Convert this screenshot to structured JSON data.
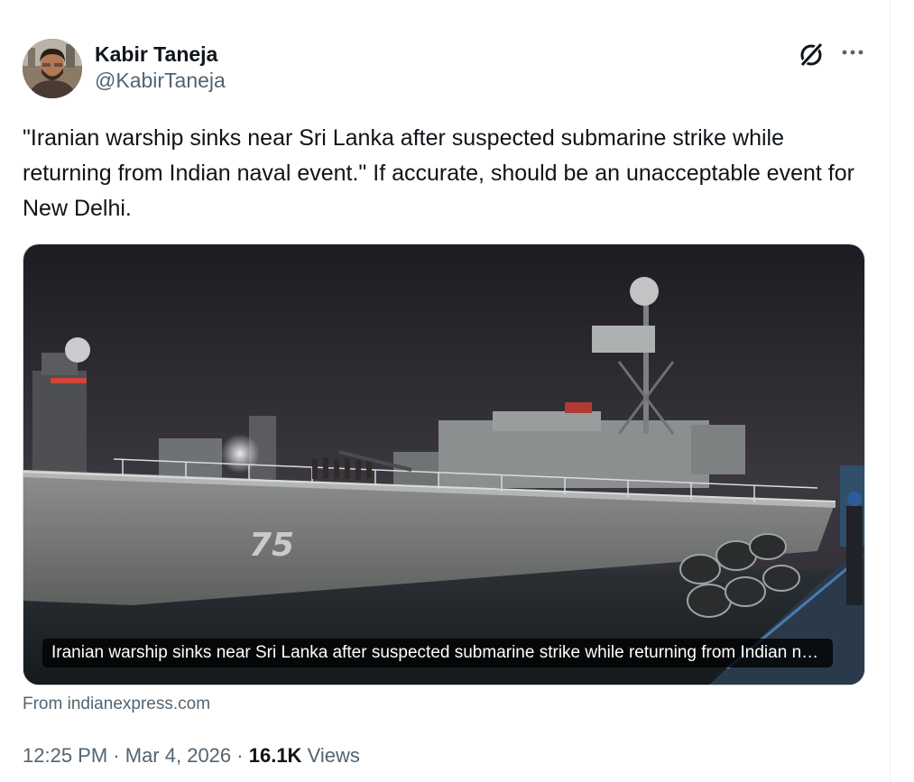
{
  "author": {
    "display_name": "Kabir Taneja",
    "handle": "@KabirTaneja"
  },
  "icons": {
    "grok": "grok-icon",
    "more": "more-dots-icon"
  },
  "tweet": {
    "text": "\"Iranian warship sinks near Sri Lanka after suspected submarine strike while returning from Indian naval event.\" If accurate, should be an unacceptable event for New Delhi."
  },
  "link_card": {
    "ship_hull_number": "75",
    "caption": "Iranian warship sinks near Sri Lanka after suspected submarine strike while returning from Indian naval event",
    "source": "From indianexpress.com"
  },
  "meta": {
    "time": "12:25 PM",
    "separator": "·",
    "date": "Mar 4, 2026",
    "views_count": "16.1K",
    "views_label": "Views"
  },
  "colors": {
    "text_primary": "#0f1419",
    "text_secondary": "#536471",
    "border": "#cfd9de"
  }
}
